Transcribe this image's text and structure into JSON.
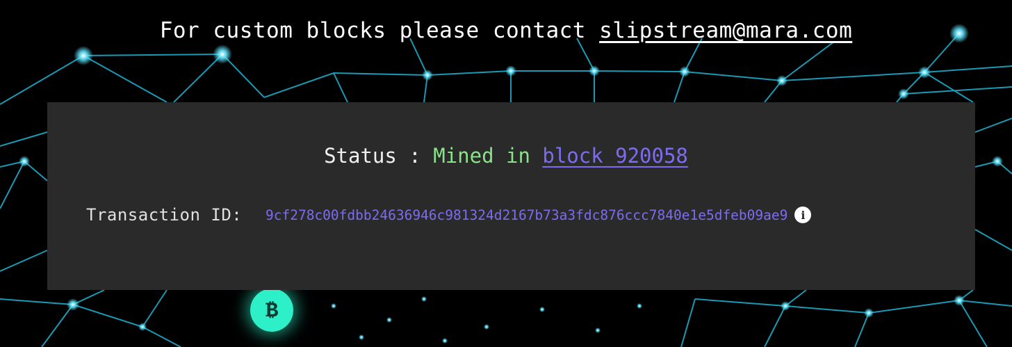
{
  "banner": {
    "prefix": "For custom blocks please contact ",
    "email": "slipstream@mara.com"
  },
  "status": {
    "label": "Status : ",
    "value": "Mined in ",
    "block_link": "block 920058"
  },
  "transaction": {
    "label": "Transaction ID:",
    "id": "9cf278c00fdbb24636946c981324d2167b73a3fdc876ccc7840e1e5dfeb09ae9",
    "info_icon": "i"
  },
  "background": {
    "coin_symbol": "₿"
  },
  "colors": {
    "status_green": "#8be28b",
    "link_purple": "#7d6cf2",
    "panel_bg": "#2a2a2a",
    "net_cyan": "#2ec8e0"
  }
}
